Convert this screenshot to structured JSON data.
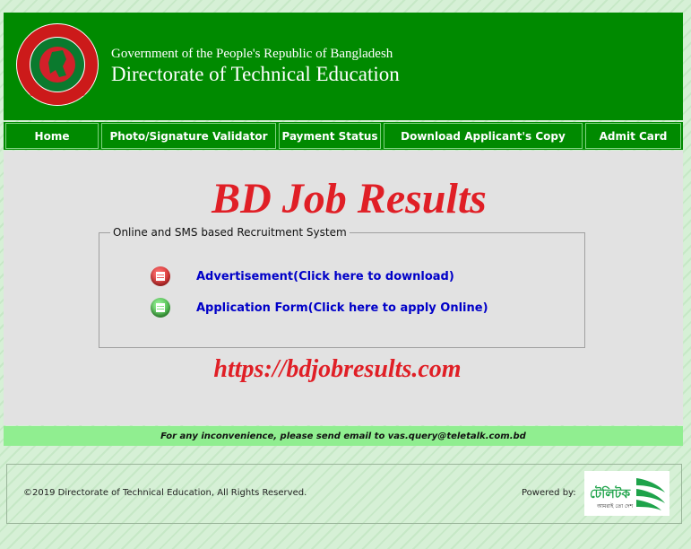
{
  "header": {
    "gov_line": "Government of the People's Republic of Bangladesh",
    "dir_line": "Directorate of Technical Education"
  },
  "nav": {
    "items": [
      {
        "label": "Home"
      },
      {
        "label": "Photo/Signature Validator"
      },
      {
        "label": "Payment Status"
      },
      {
        "label": "Download Applicant's Copy"
      },
      {
        "label": "Admit Card"
      }
    ]
  },
  "main": {
    "watermark_title": "BD Job Results",
    "fieldset_legend": "Online and SMS based Recruitment System",
    "advertisement_link": "Advertisement(Click here to download)",
    "application_link": "Application Form(Click here to apply Online)",
    "watermark_url": "https://bdjobresults.com"
  },
  "notice": "For any inconvenience, please send email to vas.query@teletalk.com.bd",
  "footer": {
    "copyright": "©2019 Directorate of Technical Education, All Rights Reserved.",
    "powered_by": "Powered by:",
    "logo_text": "টেলিটক",
    "logo_tagline": "আমরাই তো দেশ"
  },
  "colors": {
    "header_green": "#008a00",
    "notice_green": "#90ee90",
    "watermark_red": "#e01f26",
    "link_blue": "#0000c8"
  },
  "icons": {
    "advertisement": "pdf-document-icon-red",
    "application": "form-document-icon-green"
  }
}
